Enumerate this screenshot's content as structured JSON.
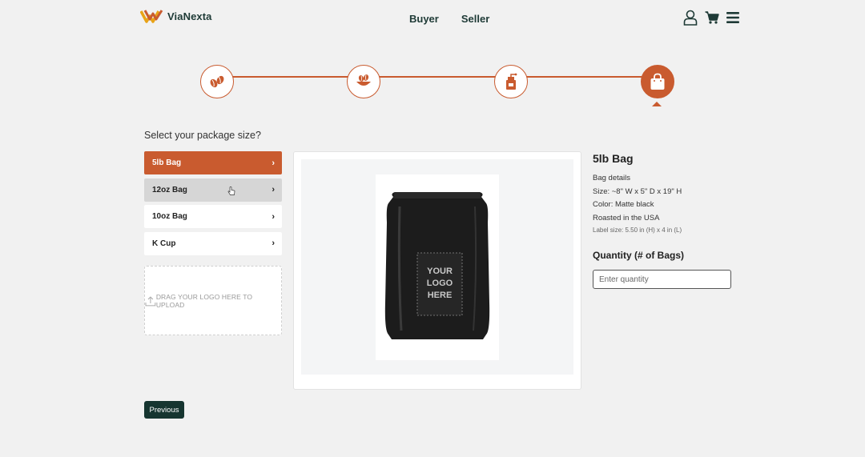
{
  "header": {
    "brand": "ViaNexta",
    "nav": [
      "Buyer",
      "Seller"
    ],
    "icons": [
      "user-icon",
      "cart-icon",
      "menu-icon"
    ]
  },
  "stepper": {
    "steps": [
      "coffee-beans-icon",
      "roasted-coffee-icon",
      "grinder-icon",
      "shopping-bag-icon"
    ],
    "active_step": 4,
    "accent": "#c95b2f"
  },
  "prompt": "Select your package size?",
  "options": [
    {
      "label": "5lb Bag",
      "state": "selected"
    },
    {
      "label": "12oz Bag",
      "state": "hover"
    },
    {
      "label": "10oz Bag",
      "state": "default"
    },
    {
      "label": "K Cup",
      "state": "default"
    }
  ],
  "upload": {
    "text": "DRAG YOUR LOGO HERE TO UPLOAD"
  },
  "preview": {
    "bag_text": [
      "YOUR",
      "LOGO",
      "HERE"
    ]
  },
  "details": {
    "title": "5lb Bag",
    "heading": "Bag details",
    "size": "Size: ~8\" W x 5\" D x 19\" H",
    "color": "Color: Matte black",
    "origin": "Roasted in the USA",
    "label_size": "Label size: 5.50 in (H) x 4 in (L)"
  },
  "quantity": {
    "label": "Quantity (# of Bags)",
    "placeholder": "Enter quantity",
    "value": ""
  },
  "footer": {
    "previous_label": "Previous"
  },
  "colors": {
    "accent": "#c95b2f",
    "dark": "#163530",
    "background": "#f1f1f1"
  }
}
